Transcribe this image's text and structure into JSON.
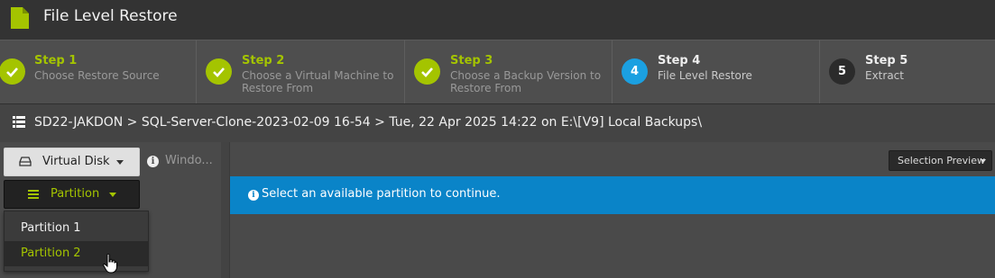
{
  "app": {
    "title": "File Level Restore"
  },
  "steps": [
    {
      "number": "1",
      "title": "Step 1",
      "description": "Choose Restore Source",
      "status": "done"
    },
    {
      "number": "2",
      "title": "Step 2",
      "description": "Choose a Virtual Machine to Restore From",
      "status": "done"
    },
    {
      "number": "3",
      "title": "Step 3",
      "description": "Choose a Backup Version to Restore From",
      "status": "done"
    },
    {
      "number": "4",
      "title": "Step 4",
      "description": "File Level Restore",
      "status": "active"
    },
    {
      "number": "5",
      "title": "Step 5",
      "description": "Extract",
      "status": "pending"
    }
  ],
  "breadcrumb": {
    "icon": "list-icon",
    "text": "SD22-JAKDON > SQL-Server-Clone-2023-02-09 16-54 > Tue, 22 Apr 2025 14:22 on E:\\[V9] Local Backups\\"
  },
  "left": {
    "virtual_disk_label": "Virtual Disk",
    "window_text": "Windo...",
    "partition_label": "Partition",
    "dropdown": [
      "Partition 1",
      "Partition 2"
    ],
    "selected_hover": "Partition 2"
  },
  "right": {
    "selection_preview_label": "Selection Preview",
    "alert_text": "Select an available partition to continue."
  },
  "colors": {
    "accent_green": "#a4c400",
    "active_blue": "#1ba0e1",
    "alert_blue": "#0a84c8"
  }
}
